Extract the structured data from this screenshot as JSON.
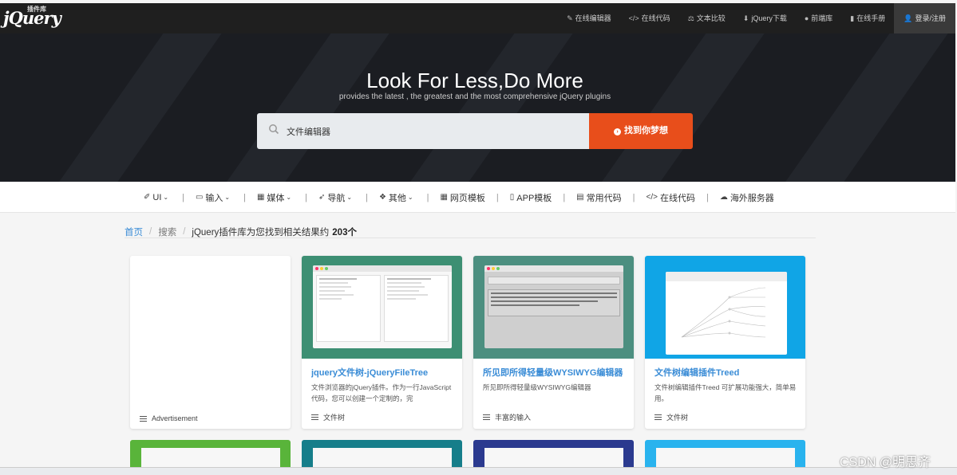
{
  "logo": {
    "text": "jQuery",
    "small": "插件库"
  },
  "topnav": [
    {
      "icon": "✎",
      "label": "在线编辑器"
    },
    {
      "icon": "</>",
      "label": "在线代码"
    },
    {
      "icon": "⚖",
      "label": "文本比较"
    },
    {
      "icon": "⬇",
      "label": "jQuery下载"
    },
    {
      "icon": "●",
      "label": "前端库"
    },
    {
      "icon": "▮",
      "label": "在线手册"
    }
  ],
  "login": {
    "icon": "👤",
    "label": "登录/注册"
  },
  "hero": {
    "title": "Look For Less,Do More",
    "subtitle": "provides the latest , the greatest and the most comprehensive jQuery plugins"
  },
  "search": {
    "value": "文件编辑器",
    "button_label": "找到你梦想"
  },
  "categories": [
    {
      "icon": "✐",
      "label": "UI",
      "dropdown": true
    },
    {
      "icon": "▭",
      "label": "输入",
      "dropdown": true
    },
    {
      "icon": "▦",
      "label": "媒体",
      "dropdown": true
    },
    {
      "icon": "➶",
      "label": "导航",
      "dropdown": true
    },
    {
      "icon": "❖",
      "label": "其他",
      "dropdown": true
    },
    {
      "icon": "▦",
      "label": "网页模板",
      "dropdown": false
    },
    {
      "icon": "▯",
      "label": "APP模板",
      "dropdown": false
    },
    {
      "icon": "▤",
      "label": "常用代码",
      "dropdown": false
    },
    {
      "icon": "</>",
      "label": "在线代码",
      "dropdown": false
    },
    {
      "icon": "☁",
      "label": "海外服务器",
      "dropdown": false
    }
  ],
  "breadcrumb": {
    "home": "首页",
    "search": "搜索",
    "result_prefix": "jQuery插件库为您找到相关结果约",
    "result_count": "203个"
  },
  "cards": [
    {
      "title": "",
      "desc": "",
      "tag": "Advertisement",
      "thumb_color": "#ffffff"
    },
    {
      "title": "jquery文件树-jQueryFileTree",
      "desc": "文件浏览器的jQuery插件。作为一行JavaScript代码，您可以创建一个定制的，完",
      "tag": "文件树",
      "thumb_color": "#3d8f73"
    },
    {
      "title": "所见即所得轻量级WYSIWYG编辑器",
      "desc": "所见即所得轻量级WYSIWYG编辑器",
      "tag": "丰富的输入",
      "thumb_color": "#4c8f80"
    },
    {
      "title": "文件树编辑插件Treed",
      "desc": "文件树编辑插件Treed 可扩展功能强大，简单易用。",
      "tag": "文件树",
      "thumb_color": "#10a5e6"
    }
  ],
  "row2_colors": [
    "#59b43a",
    "#167e8a",
    "#2b3a8f",
    "#29b3ee"
  ],
  "watermark": "CSDN @明思齐"
}
